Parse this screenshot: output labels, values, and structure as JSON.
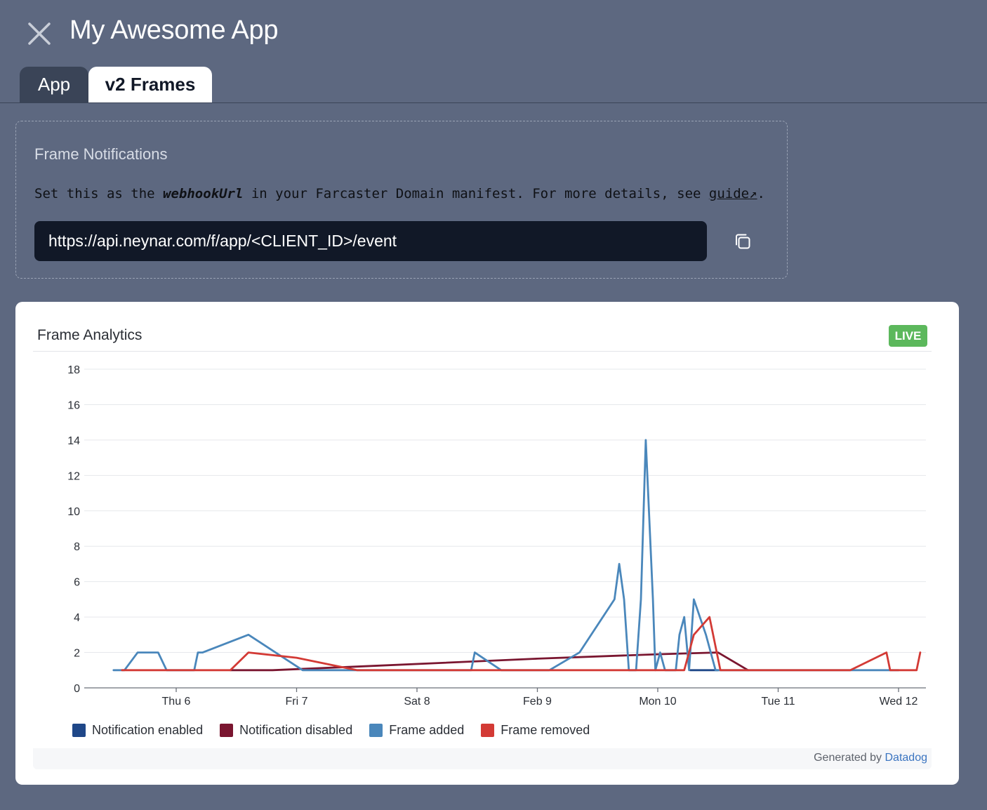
{
  "header": {
    "title": "My Awesome App",
    "close_icon": "close-icon"
  },
  "tabs": [
    {
      "label": "App",
      "active": false
    },
    {
      "label": "v2 Frames",
      "active": true
    }
  ],
  "notifications": {
    "title": "Frame Notifications",
    "desc_prefix": "Set this as the ",
    "desc_code": "webhookUrl",
    "desc_middle": " in your Farcaster Domain manifest. For more details, see ",
    "desc_link": "guide",
    "desc_link_arrow": "↗",
    "desc_suffix": ".",
    "webhook_url": "https://api.neynar.com/f/app/<CLIENT_ID>/event",
    "copy_icon": "copy-icon"
  },
  "analytics": {
    "title": "Frame Analytics",
    "badge": "LIVE",
    "generated_prefix": "Generated by ",
    "generated_link": "Datadog"
  },
  "chart_data": {
    "type": "line",
    "title": "",
    "xlabel": "",
    "ylabel": "",
    "ylim": [
      0,
      18
    ],
    "yticks": [
      0,
      2,
      4,
      6,
      8,
      10,
      12,
      14,
      16,
      18
    ],
    "xlim": [
      -0.55,
      6.1
    ],
    "xtick_labels": [
      {
        "label": "Thu 6",
        "day": 0
      },
      {
        "label": "Fri 7",
        "day": 1
      },
      {
        "label": "Sat 8",
        "day": 2
      },
      {
        "label": "Feb 9",
        "day": 3
      },
      {
        "label": "Mon 10",
        "day": 4
      },
      {
        "label": "Tue 11",
        "day": 5
      },
      {
        "label": "Wed 12",
        "day": 6
      }
    ],
    "grid": true,
    "legend_position": "bottom-left",
    "colors": {
      "Notification enabled": "#1f4788",
      "Notification disabled": "#7a1630",
      "Frame added": "#4a87bb",
      "Frame removed": "#d33a35"
    },
    "series": [
      {
        "name": "Notification enabled",
        "points": [
          [
            4.27,
            1
          ],
          [
            4.5,
            1
          ]
        ]
      },
      {
        "name": "Notification disabled",
        "points": [
          [
            0.45,
            1
          ],
          [
            0.8,
            1
          ],
          [
            1.5,
            1.2
          ],
          [
            3.0,
            1.65
          ],
          [
            4.0,
            1.9
          ],
          [
            4.5,
            2
          ],
          [
            4.75,
            1
          ]
        ]
      },
      {
        "name": "Frame added",
        "points": [
          [
            -0.52,
            1
          ],
          [
            -0.43,
            1
          ],
          [
            -0.32,
            2
          ],
          [
            -0.15,
            2
          ],
          [
            -0.08,
            1
          ],
          [
            0.15,
            1
          ],
          [
            0.18,
            2
          ],
          [
            0.22,
            2
          ],
          [
            0.6,
            3
          ],
          [
            1.05,
            1
          ],
          [
            1.5,
            1
          ],
          [
            2.45,
            1
          ],
          [
            2.48,
            2
          ],
          [
            2.7,
            1
          ],
          [
            3.1,
            1
          ],
          [
            3.35,
            2
          ],
          [
            3.64,
            5
          ],
          [
            3.68,
            7
          ],
          [
            3.72,
            5
          ],
          [
            3.76,
            1
          ],
          [
            3.82,
            1
          ],
          [
            3.86,
            5
          ],
          [
            3.9,
            14
          ],
          [
            3.96,
            5
          ],
          [
            3.98,
            1
          ],
          [
            4.02,
            2
          ],
          [
            4.06,
            1
          ],
          [
            4.15,
            1
          ],
          [
            4.18,
            3
          ],
          [
            4.22,
            4
          ],
          [
            4.26,
            1
          ],
          [
            4.3,
            5
          ],
          [
            4.4,
            3
          ],
          [
            4.48,
            1
          ],
          [
            5.0,
            1
          ],
          [
            6.0,
            1
          ]
        ]
      },
      {
        "name": "Frame removed",
        "points": [
          [
            -0.45,
            1
          ],
          [
            0.45,
            1
          ],
          [
            0.6,
            2
          ],
          [
            1.0,
            1.7
          ],
          [
            1.5,
            1
          ],
          [
            4.22,
            1
          ],
          [
            4.3,
            3
          ],
          [
            4.43,
            4
          ],
          [
            4.52,
            1
          ],
          [
            5.6,
            1
          ],
          [
            5.9,
            2
          ],
          [
            5.93,
            1
          ],
          [
            6.15,
            1
          ],
          [
            6.18,
            2
          ]
        ]
      }
    ]
  }
}
